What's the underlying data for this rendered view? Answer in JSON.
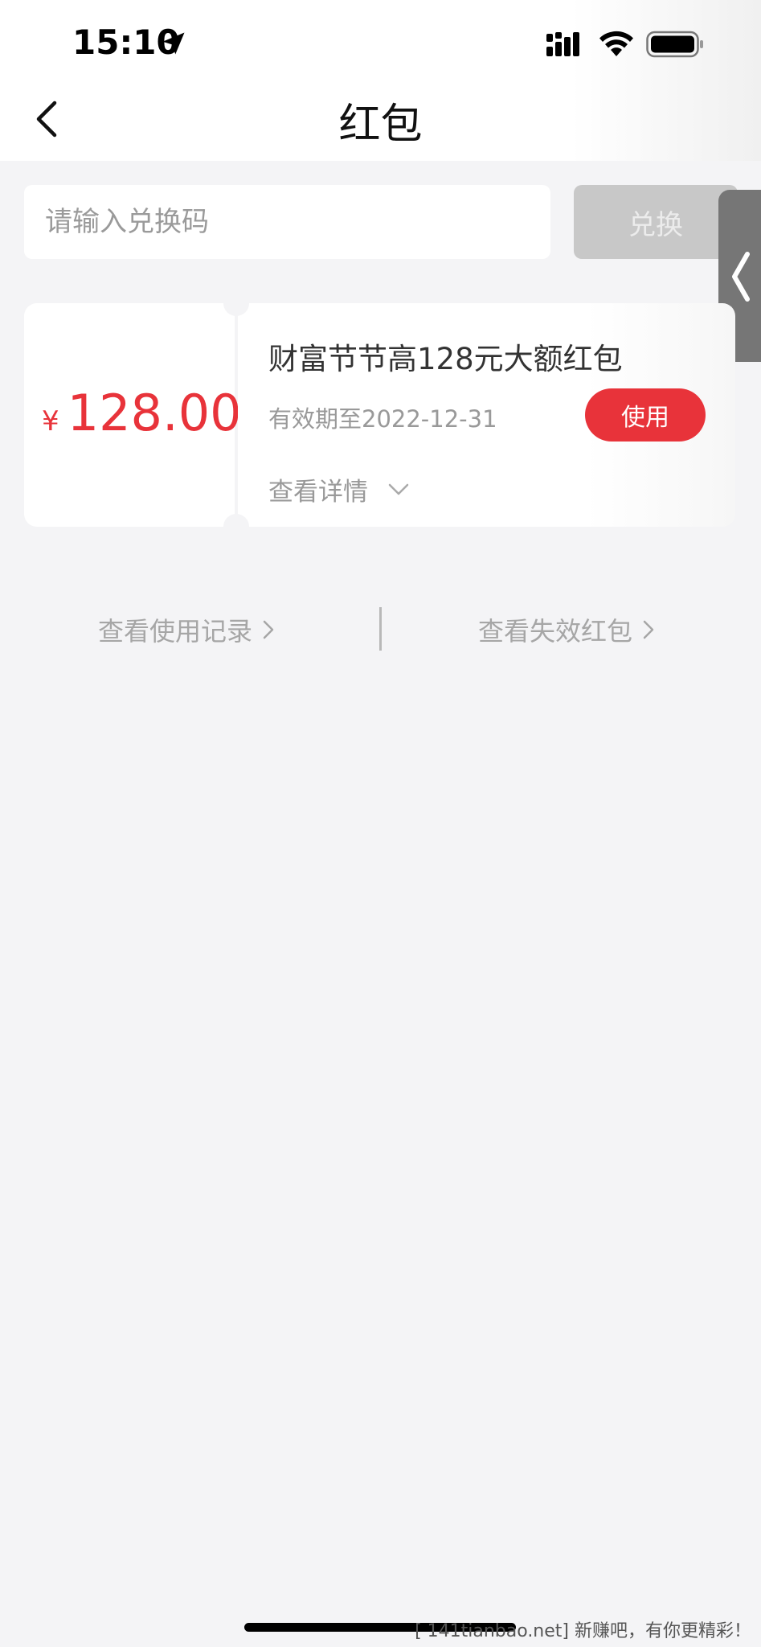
{
  "status_bar": {
    "time": "15:10"
  },
  "header": {
    "title": "红包"
  },
  "redeem": {
    "placeholder": "请输入兑换码",
    "button_label": "兑换"
  },
  "coupon": {
    "currency": "¥",
    "amount": "128.00",
    "title": "财富节节高128元大额红包",
    "validity": "有效期至2022-12-31",
    "use_label": "使用",
    "details_label": "查看详情"
  },
  "links": {
    "records": "查看使用记录",
    "expired": "查看失效红包"
  },
  "watermark": "[ 141tianbao.net] 新赚吧，有你更精彩！",
  "colors": {
    "accent": "#e8333a",
    "background": "#f4f4f6",
    "disabled_button": "#c8c8c8"
  }
}
